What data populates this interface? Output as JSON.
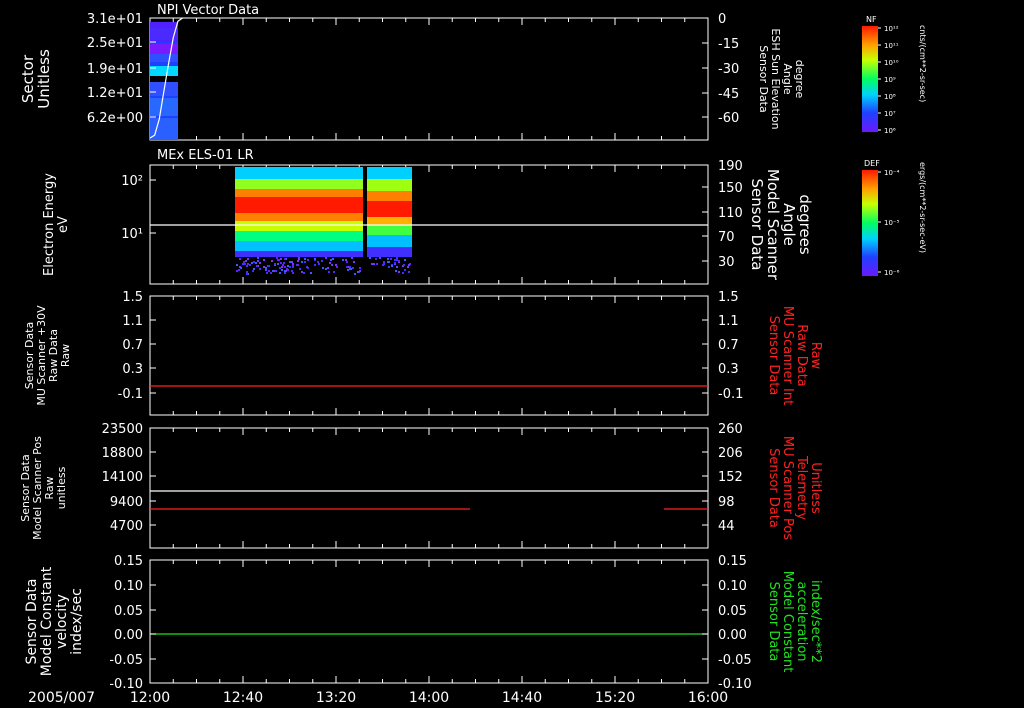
{
  "x_axis": {
    "date_label": "2005/007",
    "ticks": [
      "12:00",
      "12:40",
      "13:20",
      "14:00",
      "14:40",
      "15:20",
      "16:00"
    ],
    "range": [
      "12:00",
      "16:00"
    ]
  },
  "panels": [
    {
      "title": "NPI Vector Data",
      "left_label": [
        "Sector",
        "Unitless"
      ],
      "left_ticks": [
        "3.1e+01",
        "2.5e+01",
        "1.9e+01",
        "1.2e+01",
        "6.2e+00"
      ],
      "right_label": [
        "Sensor Data",
        "ESH Sun Elevation",
        "Angle",
        "degree"
      ],
      "right_ticks": [
        "0",
        "-15",
        "-30",
        "-45",
        "-60"
      ],
      "right_label_color": "#ffffff"
    },
    {
      "title": "MEx ELS-01 LR",
      "left_label": [
        "Electron Energy",
        "eV"
      ],
      "left_ticks": [
        "10²",
        "10¹"
      ],
      "right_label": [
        "Sensor Data",
        "Model Scanner",
        "Angle",
        "degrees"
      ],
      "right_ticks": [
        "190",
        "150",
        "110",
        "70",
        "30"
      ],
      "right_label_color": "#ffffff"
    },
    {
      "title": "",
      "left_label": [
        "Sensor Data",
        "MU Scanner +30V",
        "Raw Data",
        "Raw"
      ],
      "left_ticks": [
        "1.5",
        "1.1",
        "0.7",
        "0.3",
        "-0.1"
      ],
      "right_label": [
        "Sensor Data",
        "MU Scanner Int",
        "Raw Data",
        "Raw"
      ],
      "right_ticks": [
        "1.5",
        "1.1",
        "0.7",
        "0.3",
        "-0.1"
      ],
      "right_label_color": "#ff2020"
    },
    {
      "title": "",
      "left_label": [
        "Sensor Data",
        "Model Scanner Pos",
        "Raw",
        "unitless"
      ],
      "left_ticks": [
        "23500",
        "18800",
        "14100",
        "9400",
        "4700"
      ],
      "right_label": [
        "Sensor Data",
        "MU Scanner Pos",
        "Telemetry",
        "Unitless"
      ],
      "right_ticks": [
        "260",
        "206",
        "152",
        "98",
        "44"
      ],
      "right_label_color": "#ff2020"
    },
    {
      "title": "",
      "left_label": [
        "Sensor Data",
        "Model Constant",
        "velocity",
        "index/sec"
      ],
      "left_ticks": [
        "0.15",
        "0.10",
        "0.05",
        "0.00",
        "-0.05",
        "-0.10"
      ],
      "right_label": [
        "Sensor Data",
        "Model Constant",
        "acceleration",
        "index/sec**2"
      ],
      "right_ticks": [
        "0.15",
        "0.10",
        "0.05",
        "0.00",
        "-0.05",
        "-0.10"
      ],
      "right_label_color": "#20e020"
    }
  ],
  "colorbars": [
    {
      "title": "NF",
      "units": "cnts/(cm**2-sr-sec)",
      "ticks": [
        "10¹²",
        "10¹¹",
        "10¹⁰",
        "10⁹",
        "10⁸",
        "10⁷",
        "10⁶"
      ]
    },
    {
      "title": "DEF",
      "units": "ergs/(cm**2-sr-sec-eV)",
      "ticks": [
        "10⁻⁴",
        "10⁻⁵",
        "10⁻⁶"
      ]
    }
  ],
  "chart_data": [
    {
      "type": "heatmap",
      "title": "NPI Vector Data",
      "ylabel": "Sector Unitless",
      "y2label": "Sensor Data ESH Sun Elevation Angle degree",
      "x_range": [
        "12:00",
        "16:00"
      ],
      "ylim": [
        0,
        31
      ],
      "y2lim": [
        -75,
        0
      ],
      "data_time_range": [
        "12:00",
        "12:06"
      ],
      "line_series": [
        {
          "axis": "right",
          "color": "#ffffff",
          "x": [
            "12:00",
            "12:02",
            "12:04",
            "12:06",
            "12:08",
            "12:10",
            "12:12",
            "12:14"
          ],
          "y": [
            -75,
            -72,
            -62,
            -45,
            -28,
            -12,
            -2,
            0
          ]
        }
      ]
    },
    {
      "type": "heatmap",
      "title": "MEx ELS-01 LR",
      "ylabel": "Electron Energy eV",
      "y2label": "Sensor Data Model Scanner Angle degrees",
      "yscale": "log",
      "x_range": [
        "12:00",
        "16:00"
      ],
      "y2lim": [
        0,
        190
      ],
      "data_time_ranges": [
        [
          "12:40",
          "13:28"
        ],
        [
          "13:29",
          "13:45"
        ]
      ],
      "line_series": [
        {
          "axis": "right",
          "color": "#ffffff",
          "x": [
            "12:00",
            "16:00"
          ],
          "y": [
            90,
            90
          ]
        }
      ]
    },
    {
      "type": "line",
      "ylabel": "Sensor Data MU Scanner +30V Raw Data Raw",
      "y2label": "Sensor Data MU Scanner Int Raw Data Raw",
      "x_range": [
        "12:00",
        "16:00"
      ],
      "ylim": [
        -0.3,
        1.5
      ],
      "y2lim": [
        -0.3,
        1.5
      ],
      "series": [
        {
          "axis": "right",
          "color": "#ff2020",
          "x": [
            "12:00",
            "16:00"
          ],
          "y": [
            0.0,
            0.0
          ]
        }
      ]
    },
    {
      "type": "line",
      "ylabel": "Sensor Data Model Scanner Pos Raw unitless",
      "y2label": "Sensor Data MU Scanner Pos Telemetry Unitless",
      "x_range": [
        "12:00",
        "16:00"
      ],
      "ylim": [
        0,
        23500
      ],
      "y2lim": [
        0,
        260
      ],
      "series": [
        {
          "axis": "left",
          "color": "#ffffff",
          "x": [
            "12:00",
            "16:00"
          ],
          "y": [
            11950,
            11950
          ]
        },
        {
          "axis": "right",
          "color": "#ff2020",
          "x": [
            "12:00",
            "14:28"
          ],
          "y": [
            82,
            82
          ]
        },
        {
          "axis": "right",
          "color": "#ff2020",
          "x": [
            "15:36",
            "16:00"
          ],
          "y": [
            82,
            82
          ]
        }
      ]
    },
    {
      "type": "line",
      "ylabel": "Sensor Data Model Constant velocity index/sec",
      "y2label": "Sensor Data Model Constant acceleration index/sec**2",
      "x_range": [
        "12:00",
        "16:00"
      ],
      "ylim": [
        -0.1,
        0.15
      ],
      "y2lim": [
        -0.1,
        0.15
      ],
      "series": [
        {
          "axis": "right",
          "color": "#20e020",
          "x": [
            "12:00",
            "16:00"
          ],
          "y": [
            0.0,
            0.0
          ]
        }
      ]
    }
  ]
}
